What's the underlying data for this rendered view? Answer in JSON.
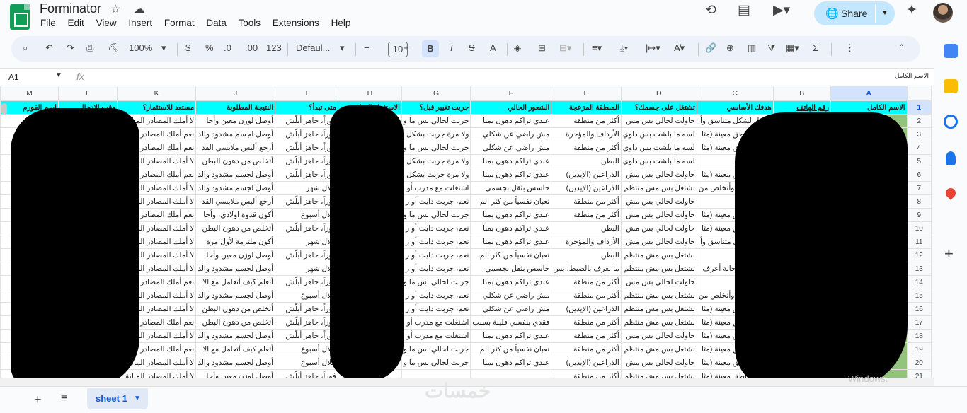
{
  "app": {
    "title": "Forminator"
  },
  "menu": [
    "File",
    "Edit",
    "View",
    "Insert",
    "Format",
    "Data",
    "Tools",
    "Extensions",
    "Help"
  ],
  "topright": {
    "share_label": "Share"
  },
  "toolbar": {
    "zoom": "100%",
    "currency": "$",
    "percent": "%",
    "dec_less": ".0",
    "dec_more": ".00",
    "format_num": "123",
    "font": "Defaul...",
    "font_size": "10",
    "bold": "B"
  },
  "formula": {
    "cell_ref": "A1",
    "fx": "fx",
    "value": "الاسم الكامل"
  },
  "columns": [
    "A",
    "B",
    "C",
    "D",
    "E",
    "F",
    "G",
    "H",
    "I",
    "J",
    "K",
    "L",
    "M"
  ],
  "rows": [
    [
      "الاسم الكامل",
      "رقم الهاتف",
      "هدفك الأساسي",
      "تشتغل على جسمك؟",
      "المنطقة المزعجة",
      "الشعور الحالي",
      "جربت تغيير قبل؟",
      "الاستثمار المناسب",
      "متى تبدأ؟",
      "النتيجة المطلوبة",
      "مستعد للاستثمار؟",
      "وقت الإدخال",
      "اسم الفورم"
    ],
    [
      "",
      "",
      "أوصل لشكل متناسق وأ",
      "حاولت لحالي بس مش",
      "أكثر من منطقة",
      "عندي تراكم دهون بمنا",
      "جربت لحالي بس ما و",
      "",
      "فوراً، جاهز أبلّش",
      "أوصل لوزن معين وأحا",
      "لا أملك المصادر المالية",
      "",
      ""
    ],
    [
      "",
      "",
      "أصغر مناطق معينة (مثا",
      "لسه ما بلشت بس داوي",
      "الأرداف والمؤخرة",
      "مش راضي عن شكلي",
      "ولا مرة جربت بشكل",
      "",
      "فوراً، جاهز أبلّش",
      "أوصل لجسم مشدود والد",
      "نعم أملك المصادر المالية",
      "",
      ""
    ],
    [
      "",
      "",
      "أصغر مناطق معينة (مثا",
      "لسه ما بلشت بس داوي",
      "أكثر من منطقة",
      "مش راضي عن شكلي",
      "جربت لحالي بس ما و",
      "",
      "فوراً، جاهز أبلّش",
      "أرجع ألبس ملابسي القد",
      "نعم أملك المصادر المالية",
      "",
      ""
    ],
    [
      "",
      "",
      "أنزل بالوزن",
      "لسه ما بلشت بس داوي",
      "البطن",
      "عندي تراكم دهون بمنا",
      "ولا مرة جربت بشكل",
      "",
      "فوراً، جاهز أبلّش",
      "أتخلص من دهون البطن",
      "لا أملك المصادر المالية",
      "",
      ""
    ],
    [
      "",
      "",
      "أصغر مناطق معينة (مثا",
      "حاولت لحالي بس مش",
      "الذراعين (الإيدين)",
      "عندي تراكم دهون بمنا",
      "ولا مرة جربت بشكل",
      "",
      "فوراً، جاهز أبلّش",
      "أوصل لجسم مشدود والد",
      "نعم أملك المصادر المالية",
      "",
      ""
    ],
    [
      "",
      "",
      "أشد الجسم وأتخلص من",
      "بشتغل بس مش منتظم",
      "الذراعين (الإيدين)",
      "حاسس بثقل بجسمي",
      "اشتغلت مع مدرب أو",
      "",
      "خلال شهر",
      "أوصل لجسم مشدود والد",
      "لا أملك المصادر المالية",
      "",
      ""
    ],
    [
      "",
      "",
      "أنزل بالوزن",
      "حاولت لحالي بس مش",
      "أكثر من منطقة",
      "تعبان نفسياً من كثر الم",
      "نعم، جربت دايت أو ر",
      "",
      "فوراً، جاهز أبلّش",
      "أرجع ألبس ملابسي القد",
      "لا أملك المصادر المالية",
      "",
      ""
    ],
    [
      "",
      "",
      "أصغر مناطق معينة (مثا",
      "حاولت لحالي بس مش",
      "أكثر من منطقة",
      "عندي تراكم دهون بمنا",
      "جربت لحالي بس ما و",
      "",
      "خلال أسبوع",
      "أكون قدوة اولادي، وأحا",
      "نعم أملك المصادر المالية",
      "",
      ""
    ],
    [
      "",
      "",
      "أصغر مناطق معينة (مثا",
      "حاولت لحالي بس مش",
      "البطن",
      "عندي تراكم دهون بمنا",
      "نعم، جربت دايت أو ر",
      "",
      "فوراً، جاهز أبلّش",
      "أتخلص من دهون البطن",
      "لا أملك المصادر المالية",
      "",
      ""
    ],
    [
      "",
      "",
      "أوصل لشكل متناسق وأ",
      "حاولت لحالي بس مش",
      "الأرداف والمؤخرة",
      "عندي تراكم دهون بمنا",
      "نعم، جربت دايت أو ر",
      "",
      "خلال شهر",
      "أكون ملتزمة لأول مرة",
      "لا أملك المصادر المالية",
      "",
      ""
    ],
    [
      "",
      "",
      "أنزل بالوزن",
      "بشتغل بس مش منتظم",
      "البطن",
      "تعبان نفسياً من كثر الم",
      "نعم، جربت دايت أو ر",
      "",
      "فوراً، جاهز أبلّش",
      "أوصل لوزن معين وأحا",
      "لا أملك المصادر المالية",
      "",
      ""
    ],
    [
      "",
      "",
      "بعرف، بس حابة أعرف",
      "بشتغل بس مش منتظم",
      "ما بعرف بالضبط، بس",
      "حاسس بثقل بجسمي",
      "نعم، جربت دايت أو ر",
      "",
      "خلال شهر",
      "أوصل لجسم مشدود والد",
      "لا أملك المصادر المالية",
      "",
      ""
    ],
    [
      "",
      "",
      "أنزل بالوزن",
      "حاولت لحالي بس مش",
      "أكثر من منطقة",
      "عندي تراكم دهون بمنا",
      "جربت لحالي بس ما و",
      "",
      "فوراً، جاهز أبلّش",
      "أتعلم كيف أتعامل مع الا",
      "نعم أملك المصادر المالية",
      "",
      ""
    ],
    [
      "",
      "",
      "أشد الجسم وأتخلص من",
      "بشتغل بس مش منتظم",
      "أكثر من منطقة",
      "مش راضي عن شكلي",
      "نعم، جربت دايت أو ر",
      "",
      "خلال أسبوع",
      "أوصل لجسم مشدود والد",
      "لا أملك المصادر المالية",
      "",
      ""
    ],
    [
      "",
      "",
      "أصغر مناطق معينة (مثا",
      "بشتغل بس مش منتظم",
      "الذراعين (الإيدين)",
      "مش راضي عن شكلي",
      "نعم، جربت دايت أو ر",
      "",
      "فوراً، جاهز أبلّش",
      "أتخلص من دهون البطن",
      "لا أملك المصادر المالية",
      "",
      ""
    ],
    [
      "",
      "",
      "أصغر مناطق معينة (مثا",
      "بشتغل بس مش منتظم",
      "أكثر من منطقة",
      "فقدي بنفسي قليلة بسبب",
      "اشتغلت مع مدرب أو",
      "",
      "فوراً، جاهز أبلّش",
      "أتخلص من دهون البطن",
      "نعم أملك المصادر المالية",
      "",
      ""
    ],
    [
      "",
      "",
      "أصغر مناطق معينة (مثا",
      "حاولت لحالي بس مش",
      "أكثر من منطقة",
      "عندي تراكم دهون بمنا",
      "اشتغلت مع مدرب أو",
      "",
      "فوراً، جاهز أبلّش",
      "أوصل لجسم مشدود والد",
      "لا أملك المصادر المالية",
      "",
      ""
    ],
    [
      "",
      "",
      "أصغر مناطق معينة (مثا",
      "بشتغل بس مش منتظم",
      "أكثر من منطقة",
      "تعبان نفسياً من كثر الم",
      "جربت لحالي بس ما و",
      "",
      "خلال أسبوع",
      "أتعلم كيف أتعامل مع الا",
      "نعم أملك المصادر المالية",
      "",
      ""
    ],
    [
      "",
      "",
      "أصغر مناطق معينة (مثا",
      "حاولت لحالي بس مش",
      "الذراعين (الإيدين)",
      "عندي تراكم دهون بمنا",
      "جربت لحالي بس ما و",
      "",
      "خلال أسبوع",
      "أوصل لجسم مشدود والد",
      "لا أملك المصادر المالية",
      "",
      ""
    ],
    [
      "",
      "",
      "أصغر مناطق معينة (مثا",
      "بشتغل بس مش منتظم",
      "أكثر من منطقة",
      "",
      "",
      "",
      "فوراً، جاهز أبلّش",
      "أوصل لوزن معين وأحا",
      "لا أملك المصادر المالية",
      "",
      ""
    ]
  ],
  "sheet": {
    "name": "sheet 1"
  },
  "watermark": "خمسات",
  "activation_hint": "Windows."
}
